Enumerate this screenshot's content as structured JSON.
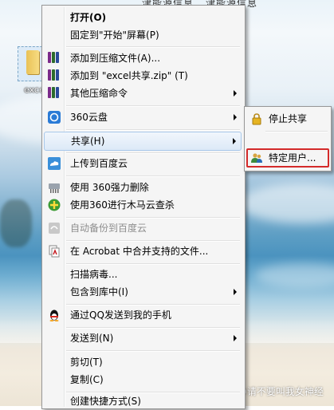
{
  "desktop": {
    "top_texts": [
      "津能源信息",
      "津能源信息"
    ],
    "folder_label": "exce",
    "watermark": "知乎 @请不要叫我女神经"
  },
  "context_menu": {
    "items": [
      {
        "label": "打开(O)",
        "icon": "none",
        "bold": true,
        "submenu": false,
        "disabled": false
      },
      {
        "label": "固定到\"开始\"屏幕(P)",
        "icon": "none",
        "submenu": false,
        "disabled": false
      },
      {
        "label": "添加到压缩文件(A)...",
        "icon": "winrar-books-icon",
        "submenu": false,
        "disabled": false
      },
      {
        "label": "添加到 \"excel共享.zip\" (T)",
        "icon": "winrar-books-icon",
        "submenu": false,
        "disabled": false
      },
      {
        "label": "其他压缩命令",
        "icon": "winrar-books-icon",
        "submenu": true,
        "disabled": false
      },
      {
        "label": "360云盘",
        "icon": "cloud-360-icon",
        "submenu": true,
        "disabled": false
      },
      {
        "label": "共享(H)",
        "icon": "none",
        "submenu": true,
        "disabled": false,
        "highlighted": true
      },
      {
        "label": "上传到百度云",
        "icon": "baidu-cloud-icon",
        "submenu": false,
        "disabled": false
      },
      {
        "label": "使用 360强力删除",
        "icon": "shredder-icon",
        "submenu": false,
        "disabled": false
      },
      {
        "label": "使用360进行木马云查杀",
        "icon": "shield-360-icon",
        "submenu": false,
        "disabled": false
      },
      {
        "label": "自动备份到百度云",
        "icon": "backup-icon",
        "submenu": false,
        "disabled": true
      },
      {
        "label": "在 Acrobat 中合并支持的文件...",
        "icon": "acrobat-icon",
        "submenu": false,
        "disabled": false
      },
      {
        "label": "扫描病毒...",
        "icon": "none",
        "submenu": false,
        "disabled": false
      },
      {
        "label": "包含到库中(I)",
        "icon": "none",
        "submenu": true,
        "disabled": false
      },
      {
        "label": "通过QQ发送到我的手机",
        "icon": "qq-penguin-icon",
        "submenu": false,
        "disabled": false
      },
      {
        "label": "发送到(N)",
        "icon": "none",
        "submenu": true,
        "disabled": false
      },
      {
        "label": "剪切(T)",
        "icon": "none",
        "submenu": false,
        "disabled": false
      },
      {
        "label": "复制(C)",
        "icon": "none",
        "submenu": false,
        "disabled": false
      },
      {
        "label": "创建快捷方式(S)",
        "icon": "none",
        "submenu": false,
        "disabled": false
      }
    ]
  },
  "share_submenu": {
    "items": [
      {
        "label": "停止共享",
        "icon": "lock-icon"
      },
      {
        "label": "特定用户...",
        "icon": "users-icon"
      }
    ]
  },
  "colors": {
    "highlight_border": "#d42a2a",
    "menu_hover": "#dce9f7"
  }
}
